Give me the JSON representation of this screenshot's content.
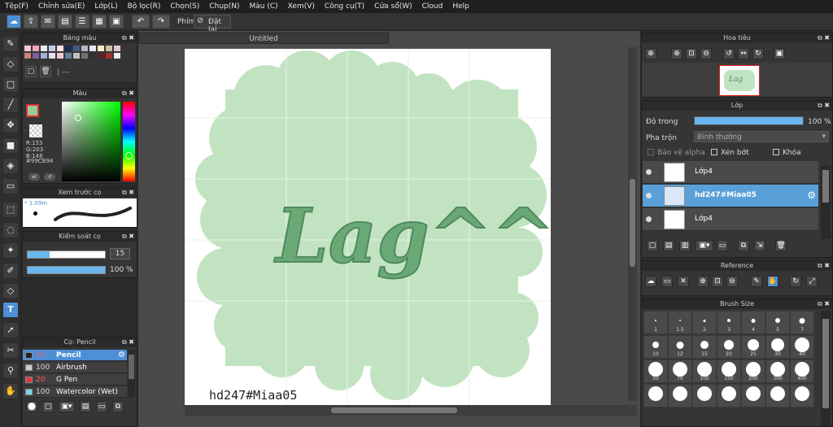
{
  "menu": [
    "Tệp(F)",
    "Chỉnh sửa(E)",
    "Lớp(L)",
    "Bộ lọc(R)",
    "Chọn(S)",
    "Chụp(N)",
    "Màu (C)",
    "Xem(V)",
    "Công cụ(T)",
    "Cửa sổ(W)",
    "Cloud",
    "Help"
  ],
  "toolbar": {
    "phim_label": "Phím",
    "reset_label": "Đặt lại"
  },
  "palette_panel": {
    "title": "Bảng màu",
    "dash_text": "| ---"
  },
  "color_panel": {
    "title": "Màu",
    "r": "R:153",
    "g": "G:203",
    "b": "B:148",
    "hex": "#99CB94"
  },
  "brush_preview": {
    "title": "Xem trước cọ",
    "size": "* 1.09m"
  },
  "brush_control": {
    "title": "Kiểm soát cọ",
    "size_value": "15",
    "opacity_value": "100 %"
  },
  "brush_list": {
    "title": "Cọ: Pencil",
    "items": [
      {
        "size": "15",
        "name": "Pencil",
        "color": "#222222",
        "selected": true
      },
      {
        "size": "100",
        "name": "Airbrush",
        "color": "#cccccc",
        "selected": false
      },
      {
        "size": "20",
        "name": "G Pen",
        "color": "#e03a3a",
        "selected": false
      },
      {
        "size": "100",
        "name": "Watercolor (Wet)",
        "color": "#7fd0f0",
        "selected": false
      }
    ]
  },
  "document": {
    "tab_title": "Untitled",
    "art_text": "Lag^^",
    "signature": "hd247#Miaa05"
  },
  "navigator": {
    "title": "Hoa tiêu",
    "thumb_text": "Lag"
  },
  "layer_panel": {
    "title": "Lớp",
    "opacity_label": "Độ trong",
    "opacity_value": "100 %",
    "blend_label": "Pha trộn",
    "blend_value": "Bình thường",
    "protect_alpha": "Bảo vệ alpha",
    "clipping": "Xén bớt",
    "lock": "Khóa",
    "layers": [
      {
        "name": "Lớp4",
        "selected": false
      },
      {
        "name": "hd247#Miaa05",
        "selected": true
      },
      {
        "name": "Lớp4",
        "selected": false
      }
    ]
  },
  "reference_panel": {
    "title": "Reference"
  },
  "brush_size_panel": {
    "title": "Brush Size",
    "sizes": [
      "1",
      "1.5",
      "2",
      "3",
      "4",
      "5",
      "7",
      "10",
      "12",
      "15",
      "20",
      "25",
      "30",
      "40",
      "50",
      "70",
      "100",
      "150",
      "200",
      "300",
      "400",
      "",
      "",
      "",
      "",
      "",
      "",
      ""
    ]
  },
  "colors": {
    "accent": "#4d8fd6",
    "art_green": "#c2e3c1",
    "text_green": "#6aa876",
    "current_color": "#99CB94"
  }
}
